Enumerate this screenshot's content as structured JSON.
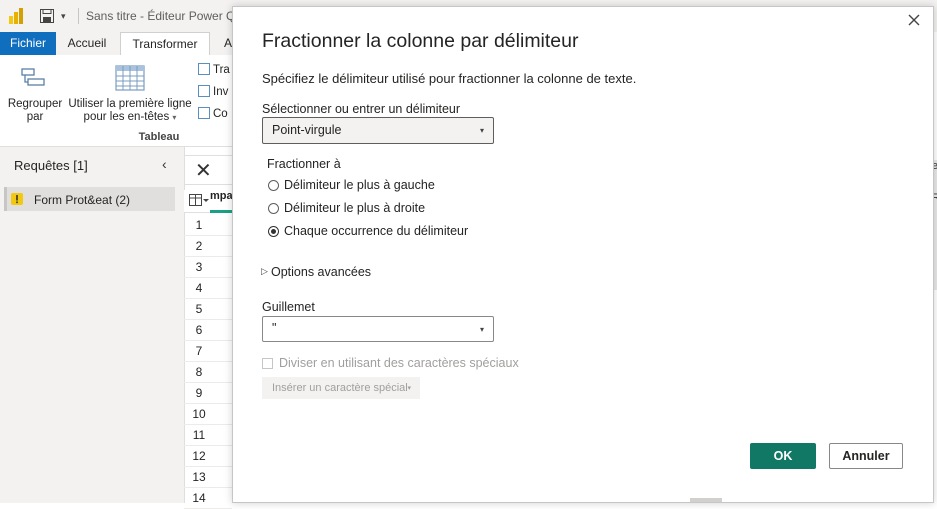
{
  "app": {
    "title": "Sans titre - Éditeur Power Q",
    "quick_access_arrow": "▾"
  },
  "tabs": [
    {
      "label": "Fichier"
    },
    {
      "label": "Accueil"
    },
    {
      "label": "Transformer"
    },
    {
      "label": "A"
    }
  ],
  "ribbon": {
    "group_by": "Regrouper par",
    "group_by_line1": "Regrouper",
    "group_by_line2": "par",
    "first_row_line1": "Utiliser la première ligne",
    "first_row_line2": "pour les en-têtes",
    "first_row_arrow": "▾",
    "group_label": "Tableau",
    "small_items": [
      "Tra",
      "Inv",
      "Co"
    ]
  },
  "queries_pane": {
    "title": "Requêtes [1]",
    "collapse": "‹",
    "items": [
      {
        "label": "Form Prot&eat (2)"
      }
    ]
  },
  "grid": {
    "formula_cancel": "✕",
    "column_header": "mpa",
    "row_numbers": [
      "1",
      "2",
      "3",
      "4",
      "5",
      "6",
      "7",
      "8",
      "9",
      "10",
      "11",
      "12",
      "13",
      "14"
    ]
  },
  "right_edge": {
    "chars": [
      "e",
      "R"
    ]
  },
  "dialog": {
    "title": "Fractionner la colonne par délimiteur",
    "description": "Spécifiez le délimiteur utilisé pour fractionner la colonne de texte.",
    "delimiter_label": "Sélectionner ou entrer un délimiteur",
    "delimiter_value": "Point-virgule",
    "split_at_label": "Fractionner à",
    "split_options": [
      {
        "label": "Délimiteur le plus à gauche",
        "checked": false
      },
      {
        "label": "Délimiteur le plus à droite",
        "checked": false
      },
      {
        "label": "Chaque occurrence du délimiteur",
        "checked": true
      }
    ],
    "advanced_arrow": "▷",
    "advanced_label": "Options avancées",
    "quote_label": "Guillemet",
    "quote_value": "\"",
    "special_chars_label": "Diviser en utilisant des caractères spéciaux",
    "insert_special_label": "Insérer un caractère spécial",
    "ok_label": "OK",
    "cancel_label": "Annuler",
    "chevron": "▾"
  },
  "colors": {
    "file_tab": "#106ebe",
    "ok_button": "#117865",
    "accent_teal": "#1aa086"
  }
}
